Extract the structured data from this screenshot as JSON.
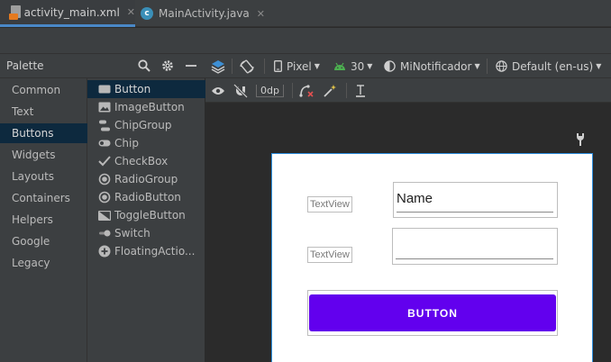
{
  "tabs": [
    {
      "label": "activity_main.xml",
      "active": true
    },
    {
      "label": "MainActivity.java",
      "active": false
    }
  ],
  "palette": {
    "title": "Palette",
    "categories": [
      "Common",
      "Text",
      "Buttons",
      "Widgets",
      "Layouts",
      "Containers",
      "Helpers",
      "Google",
      "Legacy"
    ],
    "selected_category": "Buttons",
    "items": [
      "Button",
      "ImageButton",
      "ChipGroup",
      "Chip",
      "CheckBox",
      "RadioGroup",
      "RadioButton",
      "ToggleButton",
      "Switch",
      "FloatingActio..."
    ],
    "selected_item": "Button"
  },
  "toolbar": {
    "device": "Pixel",
    "api": "30",
    "theme": "MiNotificador",
    "locale": "Default (en-us)",
    "margin": "0dp"
  },
  "design": {
    "textview1": "TextView",
    "textview2": "TextView",
    "edit1_text": "Name",
    "edit2_text": "",
    "button_label": "BUTTON"
  },
  "colors": {
    "accent": "#4a88c7",
    "button": "#6200ee",
    "selection": "#0d293e",
    "android_green": "#4caf50"
  }
}
